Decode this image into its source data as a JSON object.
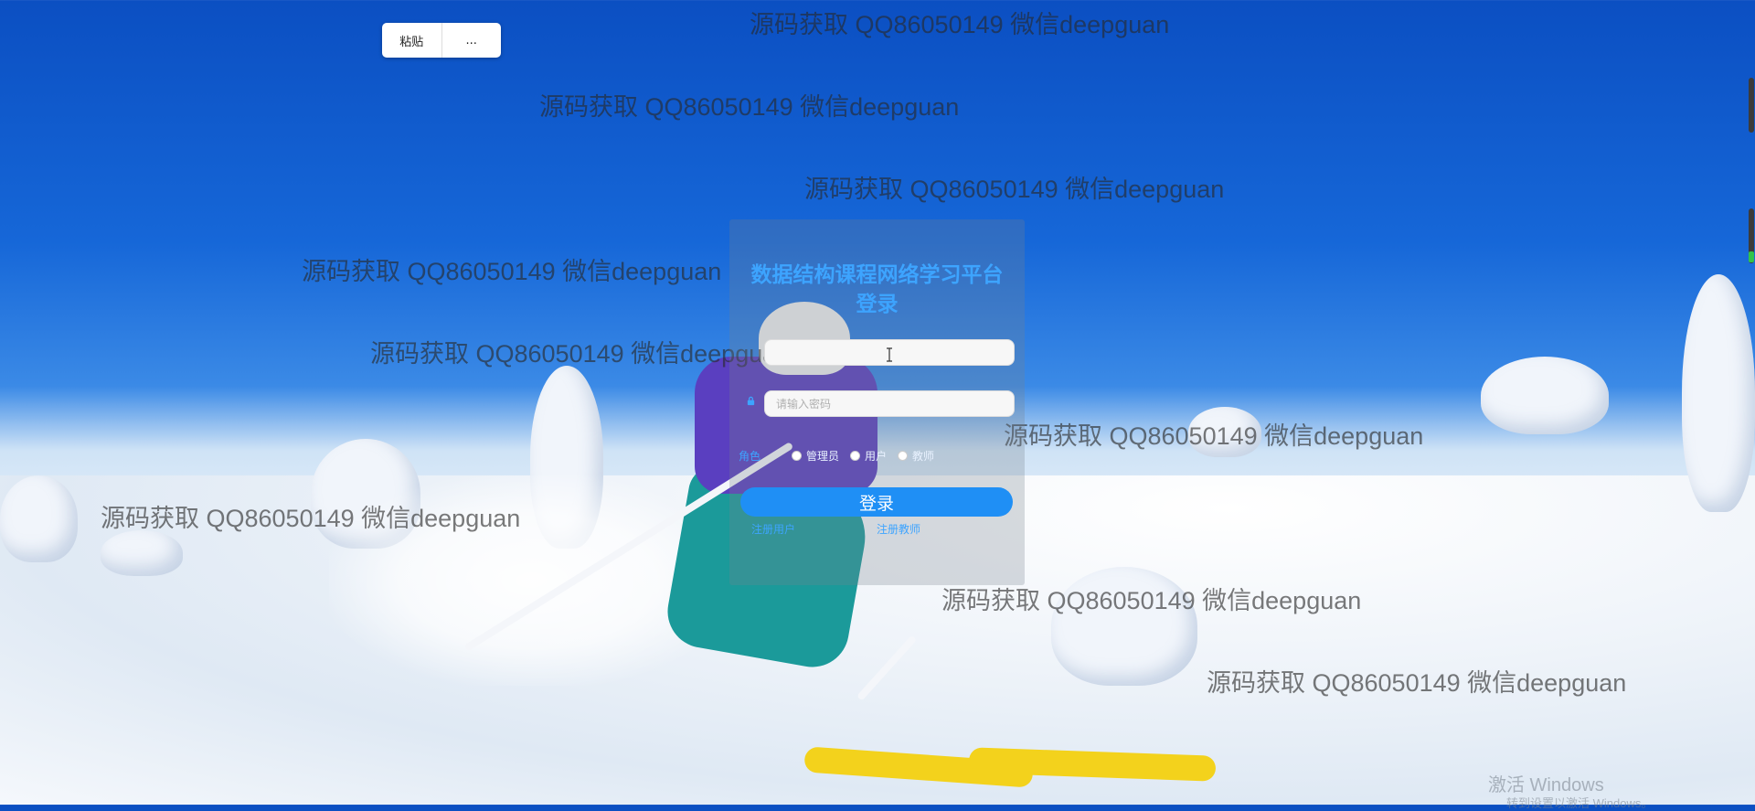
{
  "toolbar": {
    "paste_label": "粘贴",
    "more_label": "..."
  },
  "watermark": "源码获取 QQ86050149 微信deepguan",
  "login": {
    "title": "数据结构课程网络学习平台登录",
    "username_value": "",
    "password_placeholder": "请输入密码",
    "role_label": "角色",
    "roles": [
      "管理员",
      "用户",
      "教师"
    ],
    "submit_label": "登录",
    "register_user": "注册用户",
    "register_teacher": "注册教师"
  },
  "os_notice": {
    "title": "激活 Windows",
    "subtitle": "转到设置以激活 Windows。"
  },
  "colors": {
    "accent": "#1f8ff5",
    "title_blue": "#3da4ff",
    "sky": "#1667d8"
  }
}
